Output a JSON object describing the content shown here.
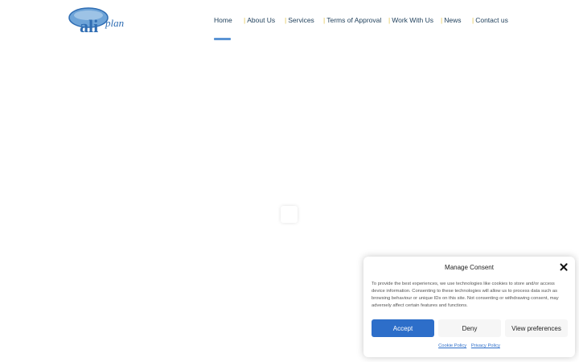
{
  "header": {
    "logo_text_main": "ali",
    "logo_text_sub": "plan",
    "nav": [
      {
        "label": "Home",
        "active": true
      },
      {
        "label": "About Us",
        "active": false
      },
      {
        "label": "Services",
        "active": false
      },
      {
        "label": "Terms of Approval",
        "active": false
      },
      {
        "label": "Work With Us",
        "active": false
      },
      {
        "label": "News",
        "active": false
      },
      {
        "label": "Contact us",
        "active": false
      }
    ],
    "separator": "|"
  },
  "consent": {
    "title": "Manage Consent",
    "body": "To provide the best experiences, we use technologies like cookies to store and/or access device information. Consenting to these technologies will allow us to process data such as browsing behaviour or unique IDs on this site. Not consenting or withdrawing consent, may adversely affect certain features and functions.",
    "accept_label": "Accept",
    "deny_label": "Deny",
    "preferences_label": "View preferences",
    "cookie_policy_label": "Cookie Policy",
    "privacy_policy_label": "Privacy Policy"
  },
  "colors": {
    "nav_text": "#1d3e5a",
    "nav_separator": "#e0c24a",
    "accent": "#2d6ec9",
    "logo_blue": "#2f6db3"
  }
}
